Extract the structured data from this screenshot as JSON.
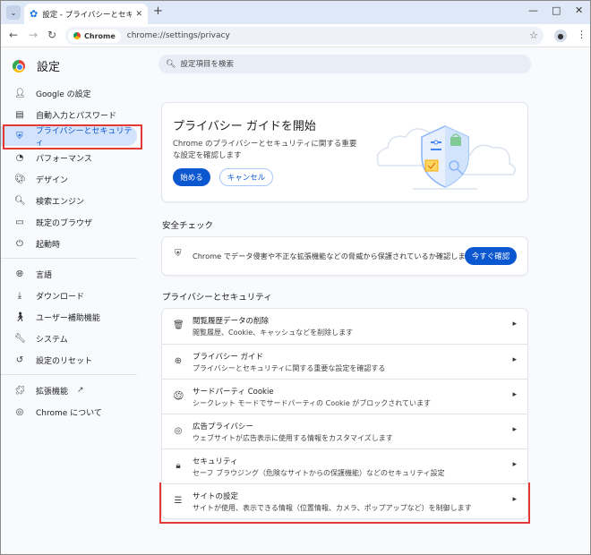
{
  "window": {
    "tab_title": "設定 - プライバシーとセキュリティ",
    "tab_icon": "gear-icon",
    "controls": [
      "—",
      "□",
      "✕"
    ]
  },
  "toolbar": {
    "chip_label": "Chrome",
    "url": "chrome://settings/privacy"
  },
  "header": {
    "title": "設定",
    "search_placeholder": "設定項目を検索"
  },
  "sidebar": {
    "items": [
      {
        "label": "Google の設定",
        "icon": "person-icon"
      },
      {
        "label": "自動入力とパスワード",
        "icon": "clipboard-icon"
      },
      {
        "label": "プライバシーとセキュリティ",
        "icon": "shield-icon",
        "active": true
      },
      {
        "label": "パフォーマンス",
        "icon": "speedometer-icon"
      },
      {
        "label": "デザイン",
        "icon": "palette-icon"
      },
      {
        "label": "検索エンジン",
        "icon": "search-icon"
      },
      {
        "label": "既定のブラウザ",
        "icon": "browser-icon"
      },
      {
        "label": "起動時",
        "icon": "power-icon"
      },
      {
        "label": "言語",
        "icon": "globe-icon"
      },
      {
        "label": "ダウンロード",
        "icon": "download-icon"
      },
      {
        "label": "ユーザー補助機能",
        "icon": "accessibility-icon"
      },
      {
        "label": "システム",
        "icon": "wrench-icon"
      },
      {
        "label": "設定のリセット",
        "icon": "history-icon"
      },
      {
        "label": "拡張機能",
        "icon": "puzzle-icon"
      },
      {
        "label": "Chrome について",
        "icon": "chrome-icon"
      }
    ]
  },
  "guide": {
    "title": "プライバシー ガイドを開始",
    "description": "Chrome のプライバシーとセキュリティに関する重要な設定を確認します",
    "start_label": "始める",
    "cancel_label": "キャンセル"
  },
  "safety": {
    "heading": "安全チェック",
    "text": "Chrome でデータ侵害や不正な拡張機能などの脅威から保護されているか確認します",
    "button_label": "今すぐ確認"
  },
  "privacy": {
    "heading": "プライバシーとセキュリティ",
    "rows": [
      {
        "title": "閲覧履歴データの削除",
        "desc": "閲覧履歴、Cookie、キャッシュなどを削除します",
        "icon": "trash-icon"
      },
      {
        "title": "プライバシー ガイド",
        "desc": "プライバシーとセキュリティに関する重要な設定を確認する",
        "icon": "privacy-guide-icon"
      },
      {
        "title": "サードパーティ Cookie",
        "desc": "シークレット モードでサードパーティの Cookie がブロックされています",
        "icon": "cookie-icon"
      },
      {
        "title": "広告プライバシー",
        "desc": "ウェブサイトが広告表示に使用する情報をカスタマイズします",
        "icon": "ad-privacy-icon"
      },
      {
        "title": "セキュリティ",
        "desc": "セーフ ブラウジング（危険なサイトからの保護機能）などのセキュリティ設定",
        "icon": "lock-icon"
      },
      {
        "title": "サイトの設定",
        "desc": "サイトが使用、表示できる情報（位置情報、カメラ、ポップアップなど）を制御します",
        "icon": "sliders-icon"
      }
    ]
  },
  "colors": {
    "accent": "#0b57d0",
    "active_bg": "#d3e3fd",
    "highlight": "#e53935"
  }
}
